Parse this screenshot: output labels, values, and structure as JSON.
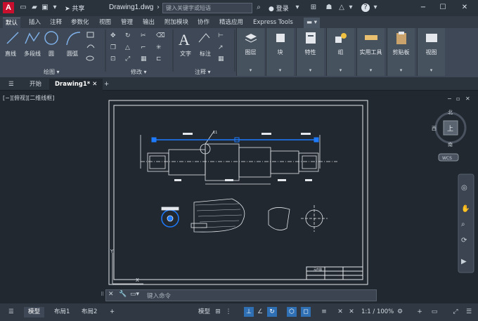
{
  "title_bar": {
    "app_logo": "A",
    "share_label": "共享",
    "doc_title": "Drawing1.dwg",
    "search_placeholder": "键入关键字或短语",
    "login_label": "登录"
  },
  "ribbon_tabs": [
    "默认",
    "插入",
    "注释",
    "参数化",
    "视图",
    "管理",
    "输出",
    "附加模块",
    "协作",
    "精选应用",
    "Express Tools"
  ],
  "ribbon": {
    "draw_tools": [
      "直线",
      "多段线",
      "圆",
      "圆弧"
    ],
    "draw_panel": "绘图",
    "modify_panel": "修改",
    "annotation_tools": [
      "文字",
      "标注"
    ],
    "annotation_panel": "注释",
    "big_tools": [
      "图层",
      "块",
      "特性",
      "组",
      "实用工具",
      "剪贴板",
      "视图"
    ]
  },
  "file_tabs": [
    "开始",
    "Drawing1*"
  ],
  "viewport": {
    "label": "[−][俯视][二维线框]",
    "compass": {
      "north": "北",
      "south": "南",
      "west": "西",
      "top": "上",
      "wcs": "WCS"
    },
    "balloon": "11",
    "title_block": "元件图"
  },
  "command_line": {
    "placeholder": "键入命令"
  },
  "status_bar": {
    "layout_tabs": [
      "模型",
      "布局1",
      "布局2"
    ],
    "model_label": "模型",
    "scale_label": "1:1 / 100%"
  },
  "colors": {
    "accent": "#2f6fb3",
    "brand": "#c8102e",
    "selection": "#1e7bff"
  }
}
